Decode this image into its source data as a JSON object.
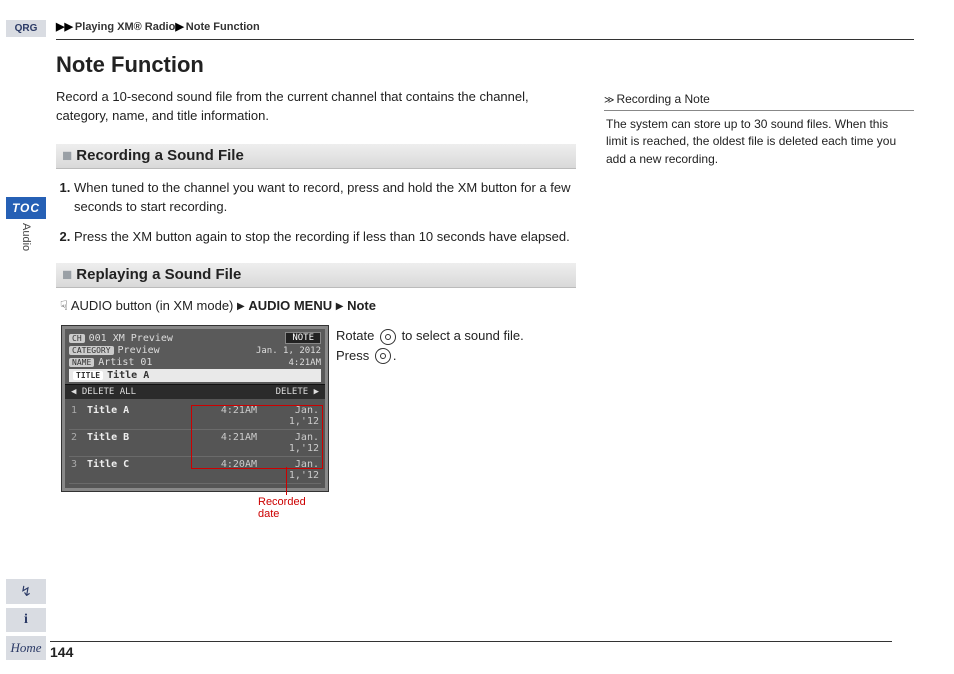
{
  "breadcrumb": {
    "lvl1": "Playing XM® Radio",
    "lvl2": "Note Function"
  },
  "title": "Note Function",
  "intro": "Record a 10-second sound file from the current channel that contains the channel, category, name, and title information.",
  "sec1": {
    "heading": "Recording a Sound File",
    "step1": "When tuned to the channel you want to record, press and hold the XM button for a few seconds to start recording.",
    "step2": "Press the XM button again to stop the recording if less than 10 seconds have elapsed."
  },
  "sec2": {
    "heading": "Replaying a Sound File",
    "nav_pre": "AUDIO button (in XM mode)",
    "nav_b1": "AUDIO MENU",
    "nav_b2": "Note",
    "instr_line1_a": "Rotate",
    "instr_line1_b": "to select a sound file.",
    "instr_line2_a": "Press",
    "instr_line2_b": "."
  },
  "device": {
    "ch_label": "CH",
    "ch_val": "001 XM Preview",
    "cat_label": "CATEGORY",
    "cat_val": "Preview",
    "name_label": "NAME",
    "name_val": "Artist 01",
    "title_label": "TITLE",
    "title_val": "Title A",
    "note_tag": "NOTE",
    "date": "Jan. 1, 2012",
    "time": "4:21AM",
    "bar_left": "◀ DELETE ALL",
    "bar_right": "DELETE ▶",
    "rows": [
      {
        "idx": "1",
        "title": "Title A",
        "time": "4:21AM",
        "date": "Jan. 1,'12"
      },
      {
        "idx": "2",
        "title": "Title B",
        "time": "4:21AM",
        "date": "Jan. 1,'12"
      },
      {
        "idx": "3",
        "title": "Title C",
        "time": "4:20AM",
        "date": "Jan. 1,'12"
      }
    ],
    "callout": "Recorded date"
  },
  "side": {
    "heading": "Recording a Note",
    "body": "The system can store up to 30 sound files. When this limit is reached, the oldest file is deleted each time you add a new recording."
  },
  "rail": {
    "qrg": "QRG",
    "toc": "TOC",
    "section": "Audio",
    "voice": "⦿",
    "info": "i",
    "home": "Home"
  },
  "page_number": "144"
}
